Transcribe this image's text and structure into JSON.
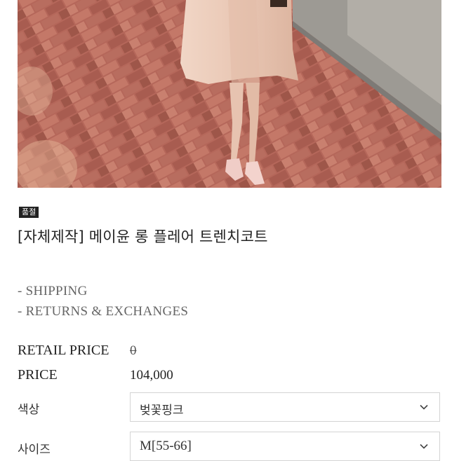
{
  "badge": {
    "label": "품절"
  },
  "product": {
    "title": "[자체제작] 메이윤 롱 플레어 트렌치코트"
  },
  "links": {
    "shipping": "- SHIPPING",
    "returns": "- RETURNS & EXCHANGES"
  },
  "pricing": {
    "retail_label": "RETAIL PRICE",
    "retail_value": "0",
    "price_label": "PRICE",
    "price_value": "104,000"
  },
  "options": {
    "color": {
      "label": "색상",
      "selected": "벚꽃핑크"
    },
    "size": {
      "label": "사이즈",
      "selected": "M[55-66]"
    }
  },
  "icons": {
    "dropdown": "chevron-down-icon"
  }
}
